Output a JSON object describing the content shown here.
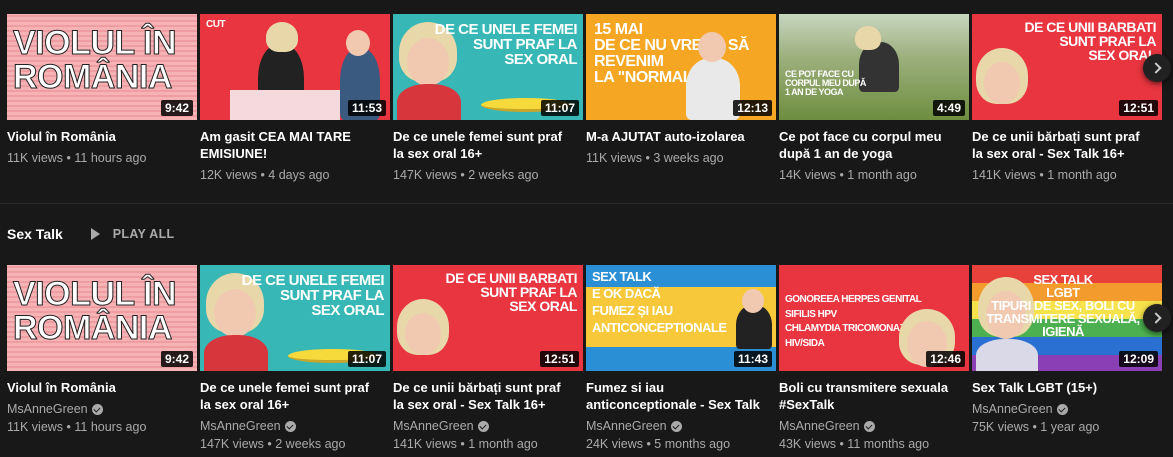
{
  "row1": [
    {
      "title": "Violul în România",
      "meta": "11K views • 11 hours ago",
      "duration": "9:42",
      "art": "Violul în\nRomânia"
    },
    {
      "title": "Am gasit CEA MAI TARE EMISIUNE!",
      "meta": "12K views • 4 days ago",
      "duration": "11:53",
      "art": "CUT"
    },
    {
      "title": "De ce unele femei sunt praf la sex oral 16+",
      "meta": "147K views • 2 weeks ago",
      "duration": "11:07",
      "art": "De ce unele femei\nsunt praf la\nsex oral"
    },
    {
      "title": "M-a AJUTAT auto-izolarea",
      "meta": "11K views • 3 weeks ago",
      "duration": "12:13",
      "art": "15 mai\nde ce nu vreau să\nrevenim\nla \"normal\""
    },
    {
      "title": "Ce pot face cu corpul meu după 1 an de yoga",
      "meta": "14K views • 1 month ago",
      "duration": "4:49",
      "art": "Ce pot face cu\ncorpul meu după\n1 an de yoga"
    },
    {
      "title": "De ce unii bărbați sunt praf la sex oral - Sex Talk 16+",
      "meta": "141K views • 1 month ago",
      "duration": "12:51",
      "art": "De ce unii barbati\nsunt praf la\nsex oral"
    }
  ],
  "shelf": {
    "title": "Sex Talk",
    "play_all": "PLAY ALL"
  },
  "row2": [
    {
      "title": "Violul în România",
      "channel": "MsAnneGreen",
      "meta": "11K views • 11 hours ago",
      "duration": "9:42",
      "art": "Violul în\nRomânia"
    },
    {
      "title": "De ce unele femei sunt praf la sex oral 16+",
      "channel": "MsAnneGreen",
      "meta": "147K views • 2 weeks ago",
      "duration": "11:07",
      "art": "De ce unele femei\nsunt praf la\nsex oral"
    },
    {
      "title": "De ce unii bărbați sunt praf la sex oral - Sex Talk 16+",
      "channel": "MsAnneGreen",
      "meta": "141K views • 1 month ago",
      "duration": "12:51",
      "art": "De ce unii barbati\nsunt praf la\nsex oral"
    },
    {
      "title": "Fumez si iau anticonceptionale - Sex Talk",
      "channel": "MsAnneGreen",
      "meta": "24K views • 5 months ago",
      "duration": "11:43",
      "art": "Sex Talk\nE ok dacă\nfumez și iau\nanticonceptionale"
    },
    {
      "title": "Boli cu transmitere sexuala #SexTalk",
      "channel": "MsAnneGreen",
      "meta": "43K views • 11 months ago",
      "duration": "12:46",
      "art": "Gonoreea  Herpes genital\nSifilis  HPV\nChlamydia  Tricomonaza\nHIV/SIDA"
    },
    {
      "title": "Sex Talk LGBT (15+)",
      "channel": "MsAnneGreen",
      "meta": "75K views • 1 year ago",
      "duration": "12:09",
      "art": "Sex Talk\nLGBT\nTipuri de sex, boli cu\ntransmitere sexuală, igienă"
    }
  ],
  "colors": {
    "background": "#181818",
    "text_primary": "#ffffff",
    "text_secondary": "#aaaaaa"
  }
}
